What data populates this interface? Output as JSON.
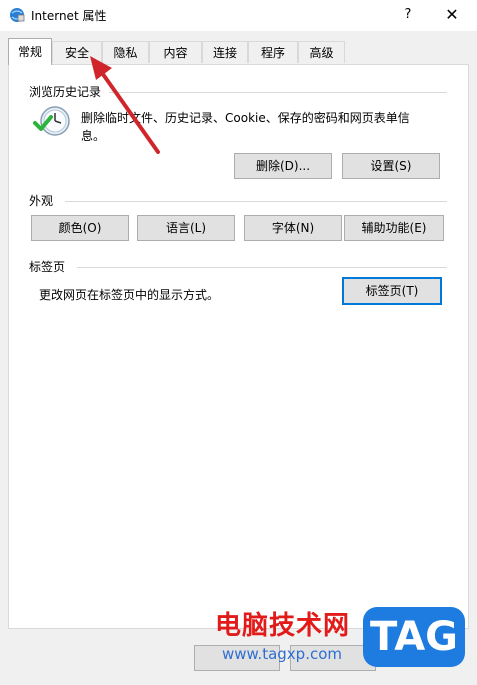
{
  "window": {
    "title": "Internet 属性",
    "help": "?",
    "close": "✕"
  },
  "tabs": [
    {
      "label": "常规",
      "active": true
    },
    {
      "label": "安全"
    },
    {
      "label": "隐私"
    },
    {
      "label": "内容"
    },
    {
      "label": "连接"
    },
    {
      "label": "程序"
    },
    {
      "label": "高级"
    }
  ],
  "history": {
    "title": "浏览历史记录",
    "description": "删除临时文件、历史记录、Cookie、保存的密码和网页表单信息。",
    "delete_label": "删除(D)...",
    "settings_label": "设置(S)"
  },
  "appearance": {
    "title": "外观",
    "colors_label": "颜色(O)",
    "languages_label": "语言(L)",
    "fonts_label": "字体(N)",
    "accessibility_label": "辅助功能(E)"
  },
  "tabs_section": {
    "title": "标签页",
    "description": "更改网页在标签页中的显示方式。",
    "tabs_label": "标签页(T)"
  },
  "watermark": {
    "site_name": "电脑技术网",
    "url": "www.tagxp.com",
    "logo": "TAG"
  },
  "colors": {
    "accent": "#0078d7",
    "arrow": "#d0262b",
    "watermark_red": "#e21a1a",
    "logo_blue": "#1e7be0"
  }
}
